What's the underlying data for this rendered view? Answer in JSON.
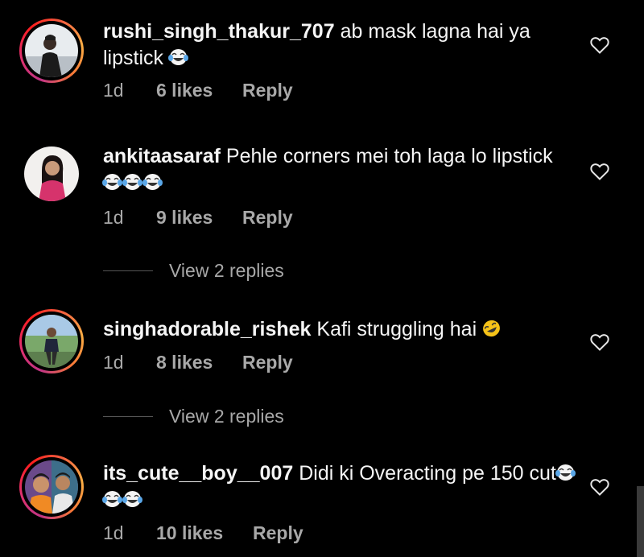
{
  "comments": [
    {
      "username": "rushi_singh_thakur_707",
      "text": "ab mask lagna hai ya lipstick",
      "emoji": [
        "laughing-tears"
      ],
      "time": "1d",
      "likes": "6 likes",
      "reply": "Reply",
      "story_ring": true
    },
    {
      "username": "ankitaasaraf",
      "text": "Pehle corners mei toh laga lo lipstick",
      "emoji": [
        "laughing-tears",
        "laughing-tears",
        "laughing-tears"
      ],
      "time": "1d",
      "likes": "9 likes",
      "reply": "Reply",
      "story_ring": false,
      "view_replies": "View 2 replies"
    },
    {
      "username": "singhadorable_rishek",
      "text": "Kafi struggling hai",
      "emoji": [
        "rolling-laughing"
      ],
      "time": "1d",
      "likes": "8 likes",
      "reply": "Reply",
      "story_ring": true,
      "view_replies": "View 2 replies"
    },
    {
      "username": "its_cute__boy__007",
      "text": "Didi ki Overacting pe 150 cut",
      "emoji": [
        "laughing-tears",
        "laughing-tears",
        "laughing-tears"
      ],
      "time": "1d",
      "likes": "10 likes",
      "reply": "Reply",
      "story_ring": true
    }
  ],
  "colors": {
    "background": "#000000",
    "primary_text": "#f5f5f5",
    "secondary_text": "#a8a8a8"
  },
  "icons": {
    "like": "heart-outline-icon",
    "emoji_1": "face-with-tears-of-joy-icon",
    "emoji_2": "rolling-on-the-floor-laughing-icon"
  }
}
